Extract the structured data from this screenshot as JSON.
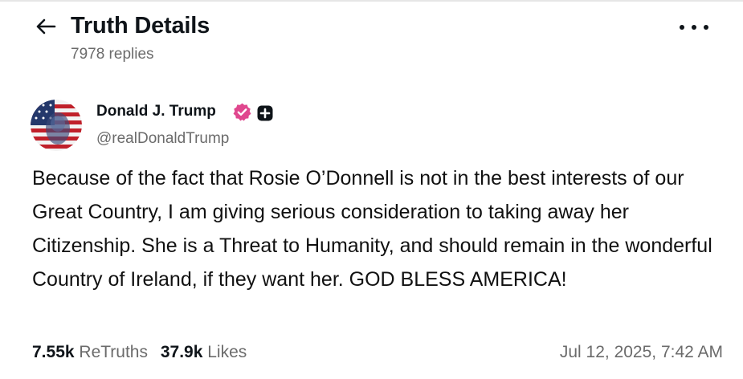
{
  "header": {
    "back_icon": "arrow-left-icon",
    "title": "Truth Details",
    "replies": "7978 replies",
    "more_icon": "more-horizontal-icon"
  },
  "post": {
    "author": {
      "name": "Donald J. Trump",
      "handle": "@realDonaldTrump",
      "verified_color": "#e0478e",
      "badge_icon": "plus-badge-icon"
    },
    "text": "Because of the fact that Rosie O’Donnell is not in the best interests of our Great Country, I am giving serious consideration to taking away her Citizenship. She is a Threat to Humanity, and should remain in the wonderful Country of Ireland, if they want her. GOD BLESS AMERICA!",
    "retruths_count": "7.55k",
    "retruths_label": "ReTruths",
    "likes_count": "37.9k",
    "likes_label": "Likes",
    "timestamp": "Jul 12, 2025, 7:42 AM"
  },
  "colors": {
    "text_primary": "#0f1419",
    "text_secondary": "#6b6b6b",
    "verified": "#e0478e"
  }
}
